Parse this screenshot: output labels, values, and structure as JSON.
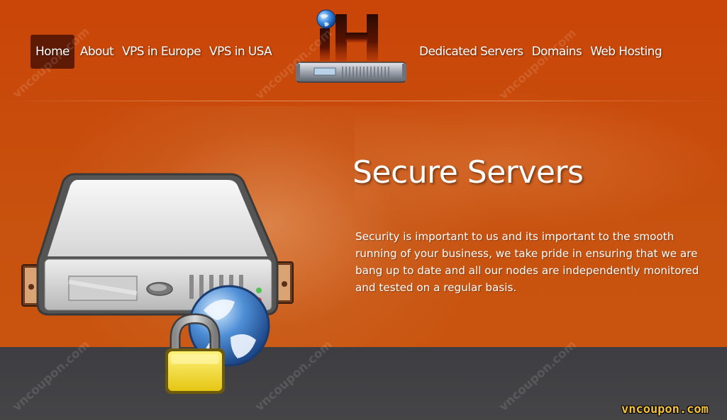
{
  "nav": {
    "left": [
      {
        "label": "Home",
        "active": true
      },
      {
        "label": "About"
      },
      {
        "label": "VPS in Europe"
      },
      {
        "label": "VPS in USA"
      }
    ],
    "right": [
      {
        "label": "Dedicated Servers"
      },
      {
        "label": "Domains"
      },
      {
        "label": "Web Hosting"
      }
    ]
  },
  "logo": {
    "text": "iH",
    "icon": "globe-server-logo-icon"
  },
  "hero": {
    "title": "Secure Servers",
    "description": "Security is important to us and its important to the smooth running of your business, we take pride in ensuring that we are bang up to date and all our nodes are independently monitored and tested on a regular basis.",
    "illustration": "secure-server-illustration"
  },
  "watermark": {
    "text": "vncoupon.com"
  },
  "brand_tag": {
    "text": "vncoupon.com"
  },
  "colors": {
    "header_orange": "#c94508",
    "active_nav": "#5e1a04",
    "footer_band": "#404043",
    "brand_yellow": "#f3c23a"
  }
}
